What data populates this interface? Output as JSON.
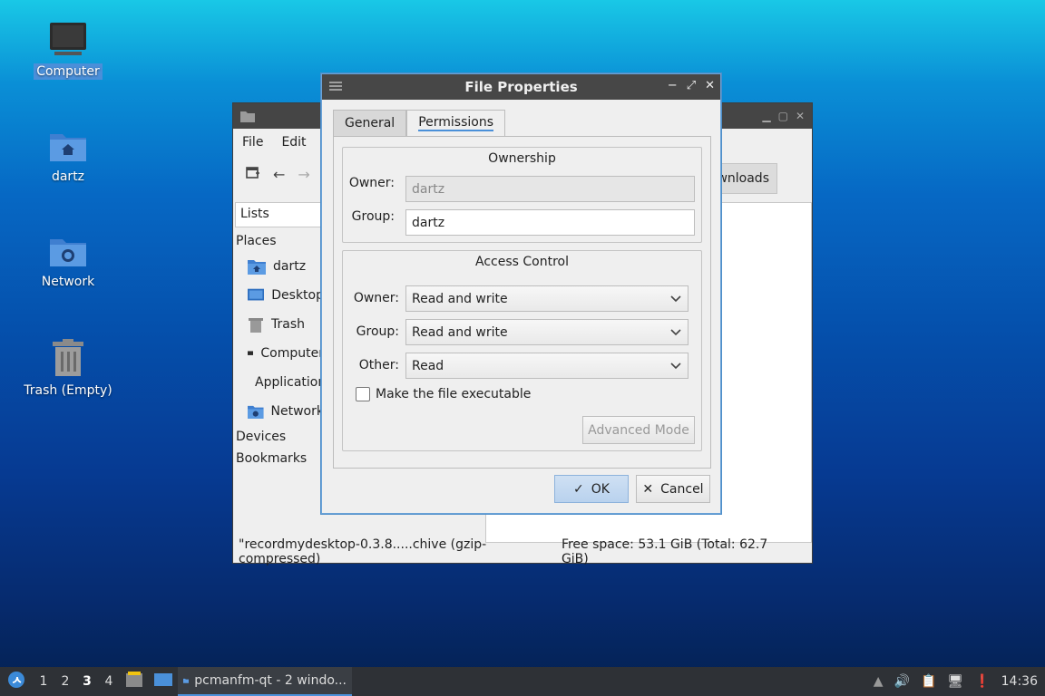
{
  "desktop": {
    "icons": [
      {
        "label": "Computer",
        "icon": "computer-icon"
      },
      {
        "label": "dartz",
        "icon": "home-folder-icon"
      },
      {
        "label": "Network",
        "icon": "network-folder-icon"
      },
      {
        "label": "Trash (Empty)",
        "icon": "trash-icon"
      }
    ]
  },
  "file_manager": {
    "menu": [
      "File",
      "Edit"
    ],
    "path_button": "wnloads",
    "side_pane_mode": "Lists",
    "sections": {
      "places": "Places",
      "devices": "Devices",
      "bookmarks": "Bookmarks"
    },
    "places": [
      "dartz",
      "Desktop",
      "Trash",
      "Computer",
      "Applications",
      "Network"
    ],
    "status_file": "\"recordmydesktop-0.3.8.....chive (gzip-compressed)",
    "status_free": "Free space: 53.1 GiB (Total: 62.7 GiB)"
  },
  "dialog": {
    "title": "File Properties",
    "tabs": [
      "General",
      "Permissions"
    ],
    "active_tab": "Permissions",
    "ownership": {
      "title": "Ownership",
      "owner_label": "Owner:",
      "owner_value": "dartz",
      "group_label": "Group:",
      "group_value": "dartz"
    },
    "access": {
      "title": "Access Control",
      "owner_label": "Owner:",
      "owner_value": "Read and write",
      "group_label": "Group:",
      "group_value": "Read and write",
      "other_label": "Other:",
      "other_value": "Read",
      "executable_label": "Make the file executable",
      "executable_checked": false,
      "advanced_label": "Advanced Mode"
    },
    "ok_label": "OK",
    "cancel_label": "Cancel"
  },
  "taskbar": {
    "workspaces": [
      "1",
      "2",
      "3",
      "4"
    ],
    "active_workspace": "3",
    "task_label": "pcmanfm-qt - 2 windo...",
    "clock": "14:36"
  }
}
